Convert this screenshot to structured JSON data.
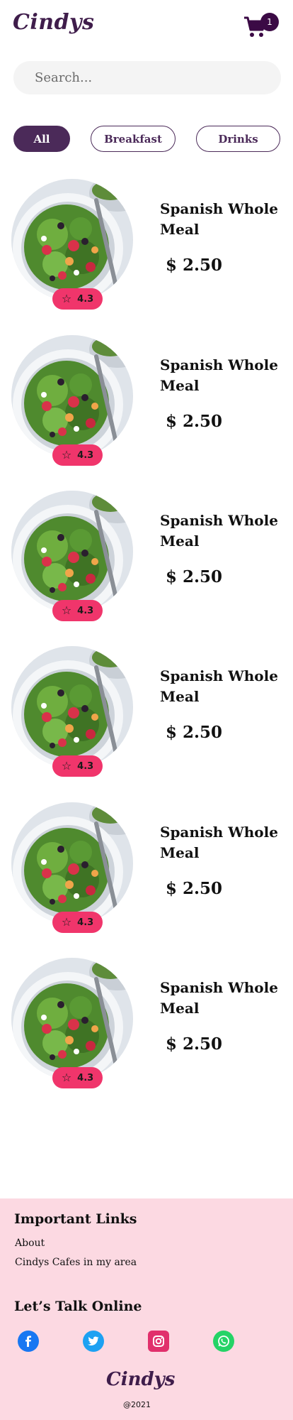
{
  "header": {
    "logo": "Cindys",
    "cart_count": "1"
  },
  "search": {
    "placeholder": "Search...",
    "value": ""
  },
  "categories": {
    "all": "All",
    "breakfast": "Breakfast",
    "drinks": "Drinks"
  },
  "items": [
    {
      "name": "Spanish Whole Meal",
      "price": "$ 2.50",
      "rating": "4.3"
    },
    {
      "name": "Spanish Whole Meal",
      "price": "$ 2.50",
      "rating": "4.3"
    },
    {
      "name": "Spanish Whole Meal",
      "price": "$ 2.50",
      "rating": "4.3"
    },
    {
      "name": "Spanish Whole Meal",
      "price": "$ 2.50",
      "rating": "4.3"
    },
    {
      "name": "Spanish Whole Meal",
      "price": "$ 2.50",
      "rating": "4.3"
    },
    {
      "name": "Spanish Whole Meal",
      "price": "$ 2.50",
      "rating": "4.3"
    }
  ],
  "footer": {
    "links_heading": "Important Links",
    "links": [
      "About",
      "Cindys Cafes in my area"
    ],
    "social_heading": "Let’s Talk Online",
    "social": [
      "facebook-icon",
      "twitter-icon",
      "instagram-icon",
      "whatsapp-icon"
    ],
    "logo": "Cindys",
    "copyright": "@2021"
  },
  "colors": {
    "brand": "#4b2a59",
    "rating": "#f0356b",
    "footer_bg": "#fcd9e2",
    "facebook": "#1877f2",
    "twitter": "#1da1f2",
    "instagram": "#e1306c",
    "whatsapp": "#25d366"
  }
}
